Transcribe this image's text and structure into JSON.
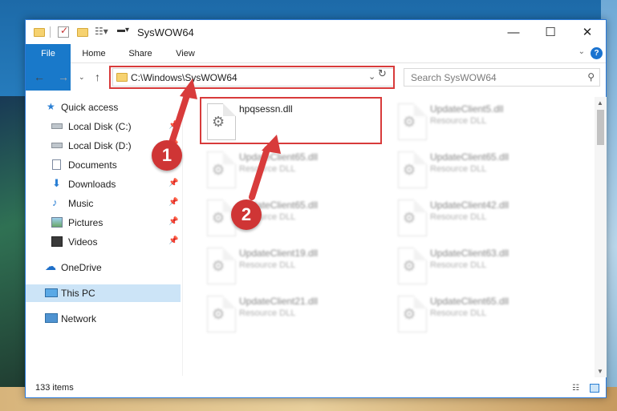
{
  "window": {
    "title": "SysWOW64",
    "controls": {
      "minimize": "—",
      "maximize": "☐",
      "close": "✕"
    }
  },
  "ribbon": {
    "tabs": [
      "File",
      "Home",
      "Share",
      "View"
    ],
    "help": "?"
  },
  "address": {
    "path": "C:\\Windows\\SysWOW64",
    "search_placeholder": "Search SysWOW64"
  },
  "nav": {
    "items": [
      {
        "label": "Quick access",
        "icon": "star-icon",
        "pinned": false
      },
      {
        "label": "Local Disk (C:)",
        "icon": "drive-icon",
        "pinned": true
      },
      {
        "label": "Local Disk (D:)",
        "icon": "drive-icon",
        "pinned": true
      },
      {
        "label": "Documents",
        "icon": "documents-icon",
        "pinned": true
      },
      {
        "label": "Downloads",
        "icon": "download-icon",
        "pinned": true
      },
      {
        "label": "Music",
        "icon": "music-icon",
        "pinned": true
      },
      {
        "label": "Pictures",
        "icon": "pictures-icon",
        "pinned": true
      },
      {
        "label": "Videos",
        "icon": "videos-icon",
        "pinned": true
      },
      {
        "label": "OneDrive",
        "icon": "cloud-icon",
        "pinned": false
      },
      {
        "label": "This PC",
        "icon": "computer-icon",
        "pinned": false,
        "selected": true
      },
      {
        "label": "Network",
        "icon": "network-icon",
        "pinned": false
      }
    ]
  },
  "files": [
    {
      "name": "hpqsessn.dll",
      "type": "",
      "highlighted": true
    },
    {
      "name": "UpdateClient5.dll",
      "type": "Resource DLL"
    },
    {
      "name": "UpdateClient65.dll",
      "type": "Resource DLL"
    },
    {
      "name": "UpdateClient65.dll",
      "type": "Resource DLL"
    },
    {
      "name": "UpdateClient65.dll",
      "type": "Resource DLL"
    },
    {
      "name": "UpdateClient42.dll",
      "type": "Resource DLL"
    },
    {
      "name": "UpdateClient19.dll",
      "type": "Resource DLL"
    },
    {
      "name": "UpdateClient63.dll",
      "type": "Resource DLL"
    },
    {
      "name": "UpdateClient21.dll",
      "type": "Resource DLL"
    },
    {
      "name": "UpdateClient65.dll",
      "type": "Resource DLL"
    }
  ],
  "status": {
    "item_count": "133 items"
  },
  "annotations": {
    "step1": "1",
    "step2": "2"
  },
  "colors": {
    "accent": "#1979ca",
    "annotation": "#d83b3b"
  }
}
